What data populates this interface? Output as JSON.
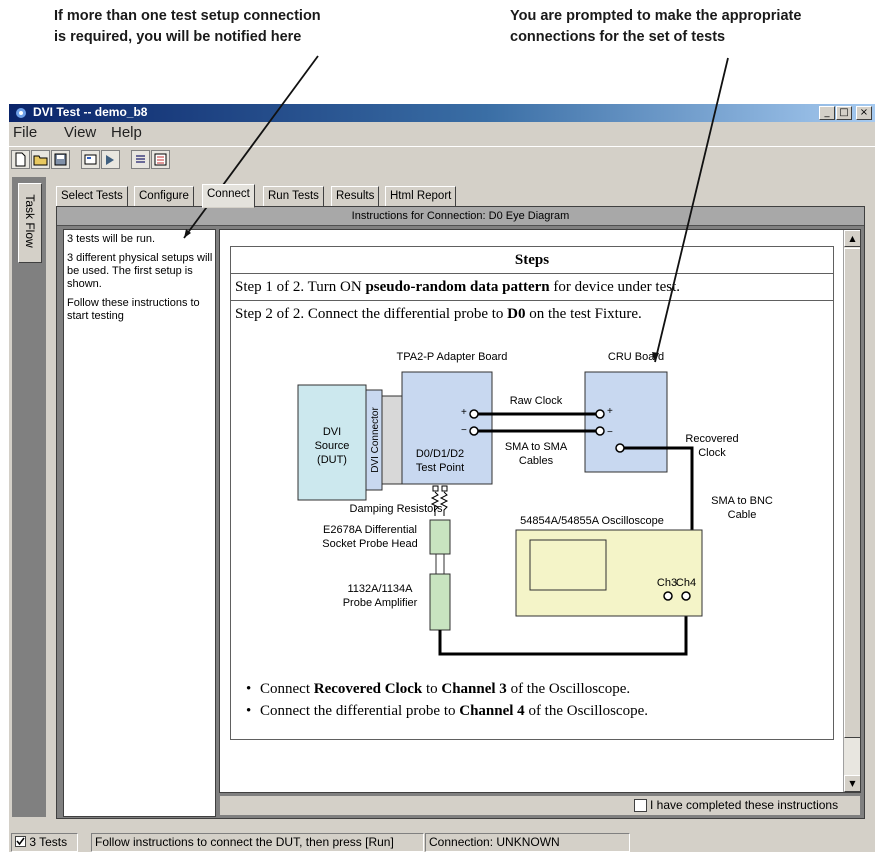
{
  "callouts": {
    "left_line1": "If more than one test setup connection",
    "left_line2": "is required, you will be notified here",
    "right_line1": "You are prompted to make the appropriate",
    "right_line2": "connections for the set of tests"
  },
  "window": {
    "title": "DVI Test -- demo_b8",
    "minimize": "_",
    "maximize": "□",
    "close": "×"
  },
  "menu": [
    "File",
    "View",
    "Help"
  ],
  "task_flow": "Task Flow",
  "tabs": [
    "Select Tests",
    "Configure",
    "Connect",
    "Run Tests",
    "Results",
    "Html Report"
  ],
  "active_tab": "Connect",
  "panel_header": "Instructions for Connection: D0 Eye Diagram",
  "left_info": {
    "p1": "3 tests will be run.",
    "p2": "3 different physical setups will be used.  The first setup is shown.",
    "p3": "Follow these instructions to start testing"
  },
  "steps": {
    "heading": "Steps",
    "step1_prefix": "Step 1 of 2. Turn ON ",
    "step1_bold": "pseudo-random data pattern",
    "step1_suffix": " for device under test.",
    "step2_prefix": "Step 2 of 2. Connect the differential probe to ",
    "step2_bold": "D0",
    "step2_suffix": " on the test Fixture."
  },
  "diagram": {
    "adapter_title": "TPA2-P Adapter Board",
    "cru_title": "CRU Board",
    "dvi_source_1": "DVI",
    "dvi_source_2": "Source",
    "dvi_source_3": "(DUT)",
    "dvi_connector": "DVI Connector",
    "test_point_1": "D0/D1/D2",
    "test_point_2": "Test Point",
    "raw_clock": "Raw Clock",
    "sma_to_sma_1": "SMA to SMA",
    "sma_to_sma_2": "Cables",
    "recovered_clock_1": "Recovered",
    "recovered_clock_2": "Clock",
    "sma_to_bnc_1": "SMA to BNC",
    "sma_to_bnc_2": "Cable",
    "damping": "Damping Resistors",
    "probe_head_1": "E2678A Differential",
    "probe_head_2": "Socket Probe Head",
    "amplifier_1": "1132A/1134A",
    "amplifier_2": "Probe Amplifier",
    "scope_title": "54854A/54855A Oscilloscope",
    "ch3": "Ch3",
    "ch4": "Ch4",
    "plus": "+",
    "minus": "−"
  },
  "bullets": {
    "b1_prefix": "Connect ",
    "b1_bold1": "Recovered Clock",
    "b1_mid": " to ",
    "b1_bold2": "Channel 3",
    "b1_suffix": " of the Oscilloscope.",
    "b2_prefix": "Connect the differential probe to ",
    "b2_bold": "Channel 4",
    "b2_suffix": " of the Oscilloscope."
  },
  "completed_label": "I have completed these instructions",
  "status": {
    "tests": "3 Tests",
    "message": "Follow instructions to connect the DUT, then press [Run]",
    "connection": "Connection: UNKNOWN"
  },
  "colors": {
    "title_bar": "#0a246a",
    "board_fill": "#c8d8f0",
    "dvi_fill": "#cce8ee",
    "probe_fill": "#c8e4c0",
    "scope_fill": "#f4f4c8"
  }
}
